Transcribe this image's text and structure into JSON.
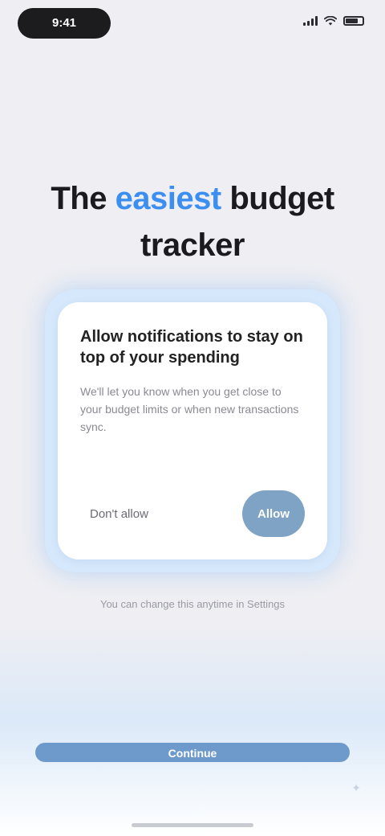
{
  "status_bar": {
    "time": "9:41",
    "icons": [
      "signal-icon",
      "wifi-icon",
      "battery-icon"
    ]
  },
  "headline": {
    "line1_before": "The ",
    "accent_word": "easiest",
    "line1_after": " budget",
    "line2": "tracker"
  },
  "card": {
    "title": "Allow notifications to stay on top of your spending",
    "body": "We'll let you know when you get close to your budget limits or when new transactions sync.",
    "secondary_button": "Don't allow",
    "primary_button": "Allow"
  },
  "caption": "You can change this anytime in Settings",
  "cta_button": "Continue",
  "corner_icon": "sparkle-icon",
  "colors": {
    "accent": "#3c8ff0",
    "primary_button": "#7fa3c4",
    "cta": "#6d9acb",
    "background": "#eeeef3"
  }
}
